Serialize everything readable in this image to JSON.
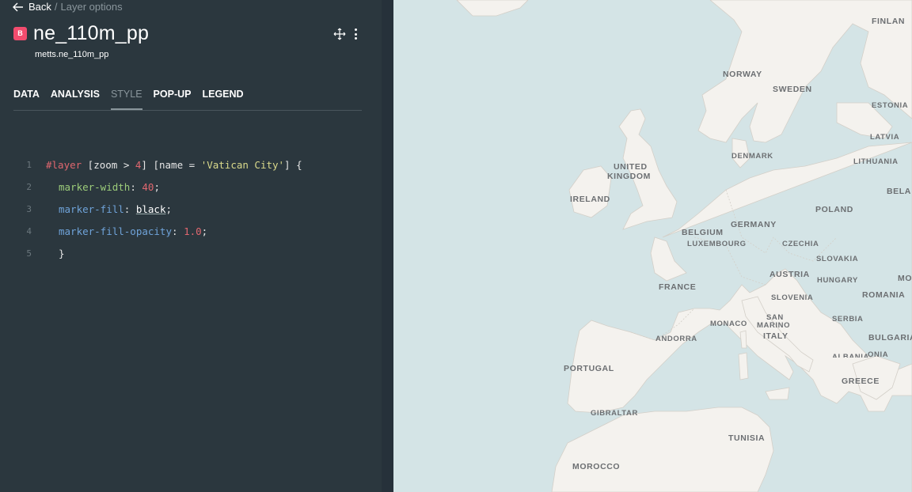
{
  "breadcrumb": {
    "back": "Back",
    "separator": "/",
    "current": "Layer options"
  },
  "layer": {
    "badge": "B",
    "title": "ne_110m_pp",
    "subtitle": "metts.ne_110m_pp"
  },
  "tabs": [
    {
      "label": "DATA"
    },
    {
      "label": "ANALYSIS"
    },
    {
      "label": "STYLE",
      "active": true
    },
    {
      "label": "POP-UP"
    },
    {
      "label": "LEGEND"
    }
  ],
  "code": {
    "line_numbers": [
      "1",
      "2",
      "3",
      "4",
      "5"
    ],
    "l1": {
      "selector": "#layer",
      "f1": " [zoom > ",
      "num": "4",
      "f2": "] [name = ",
      "str": "'Vatican City'",
      "f3": "] {"
    },
    "l2": {
      "prop": "marker-width",
      "colon": ": ",
      "val": "40",
      "semi": ";"
    },
    "l3": {
      "prop": "marker-fill",
      "colon": ": ",
      "val": "black",
      "semi": ";"
    },
    "l4": {
      "prop": "marker-fill-opacity",
      "colon": ": ",
      "val": "1.0",
      "semi": ";"
    },
    "l5": {
      "close": "}"
    }
  },
  "map": {
    "colors": {
      "water": "#d4e4e6",
      "land": "#f4f2ee",
      "border": "#d3cfc8"
    },
    "labels": {
      "finland": "FINLAN",
      "norway": "NORWAY",
      "sweden": "SWEDEN",
      "estonia": "ESTONIA",
      "latvia": "LATVIA",
      "lithuania": "LITHUANIA",
      "belarus": "BELA",
      "denmark": "DENMARK",
      "uk1": "UNITED",
      "uk2": "KINGDOM",
      "ireland": "IRELAND",
      "poland": "POLAND",
      "belgium": "BELGIUM",
      "germany": "GERMANY",
      "luxembourg": "LUXEMBOURG",
      "czechia": "CZECHIA",
      "slovakia": "SLOVAKIA",
      "france": "FRANCE",
      "austria": "AUSTRIA",
      "hungary": "HUNGARY",
      "moldova": "MO",
      "slovenia": "SLOVENIA",
      "romania": "ROMANIA",
      "san1": "SAN",
      "san2": "MARINO",
      "monaco": "MONACO",
      "serbia": "SERBIA",
      "andorra": "ANDORRA",
      "italy": "ITALY",
      "bulgaria": "BULGARIA",
      "albania": "ALBANIA",
      "macedonia": "ONIA",
      "portugal": "PORTUGAL",
      "greece": "GREECE",
      "gibraltar": "GIBRALTAR",
      "tunisia": "TUNISIA",
      "morocco": "MOROCCO"
    }
  }
}
